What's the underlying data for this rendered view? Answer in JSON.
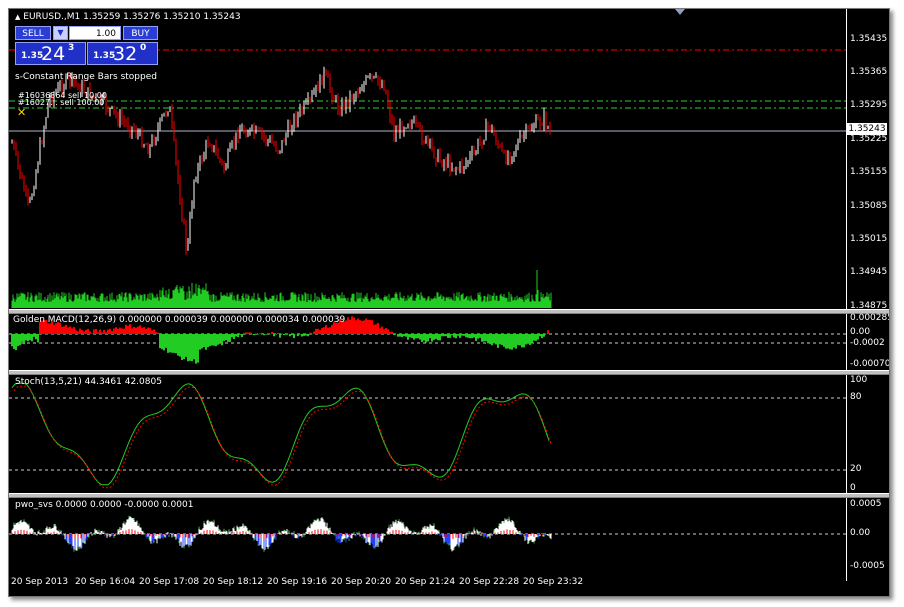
{
  "header": {
    "title": "EURUSD.,M1  1.35259 1.35276 1.35210 1.35243"
  },
  "trade_panel": {
    "sell_label": "SELL",
    "buy_label": "BUY",
    "lot_value": "1.00",
    "bid_small": "1.35",
    "bid_big": "24",
    "bid_sup": "3",
    "ask_small": "1.35",
    "ask_big": "32",
    "ask_sup": "0"
  },
  "chart_labels": {
    "status_text": "s-Constant Range Bars stopped",
    "order1": "#16036864 sell 10.00",
    "order2": "#16027... sell 100.00"
  },
  "price_axis": {
    "ticks": [
      "1.35435",
      "1.35365",
      "1.35295",
      "1.35225",
      "1.35155",
      "1.35085",
      "1.35015",
      "1.34945",
      "1.34875"
    ],
    "current": "1.35243"
  },
  "macd": {
    "label": "Golden MACD(12,26,9) 0.000000 0.000039 0.000000 0.000034 0.000039",
    "ticks": [
      "0.000285",
      "0.00",
      "-0.0002",
      "-0.000706"
    ]
  },
  "stoch": {
    "label": "Stoch(13,5,21) 44.3461 42.0805",
    "ticks": [
      "100",
      "80",
      "20",
      "0"
    ]
  },
  "pwo": {
    "label": "pwo_svs 0.0000 0.0000 -0.0000 0.0001",
    "ticks": [
      "0.0005",
      "0.00",
      "-0.0005"
    ]
  },
  "time_axis": {
    "ticks": [
      "20 Sep 2013",
      "20 Sep 16:04",
      "20 Sep 17:08",
      "20 Sep 18:12",
      "20 Sep 19:16",
      "20 Sep 20:20",
      "20 Sep 21:24",
      "20 Sep 22:28",
      "20 Sep 23:32"
    ]
  },
  "colors": {
    "background": "#000000",
    "bull": "#ffffff",
    "bear": "#ff0000",
    "volume": "#22cc22",
    "panel_blue": "#2030c8",
    "sell_line": "#ff0000",
    "tp_line": "#33cc33"
  }
}
